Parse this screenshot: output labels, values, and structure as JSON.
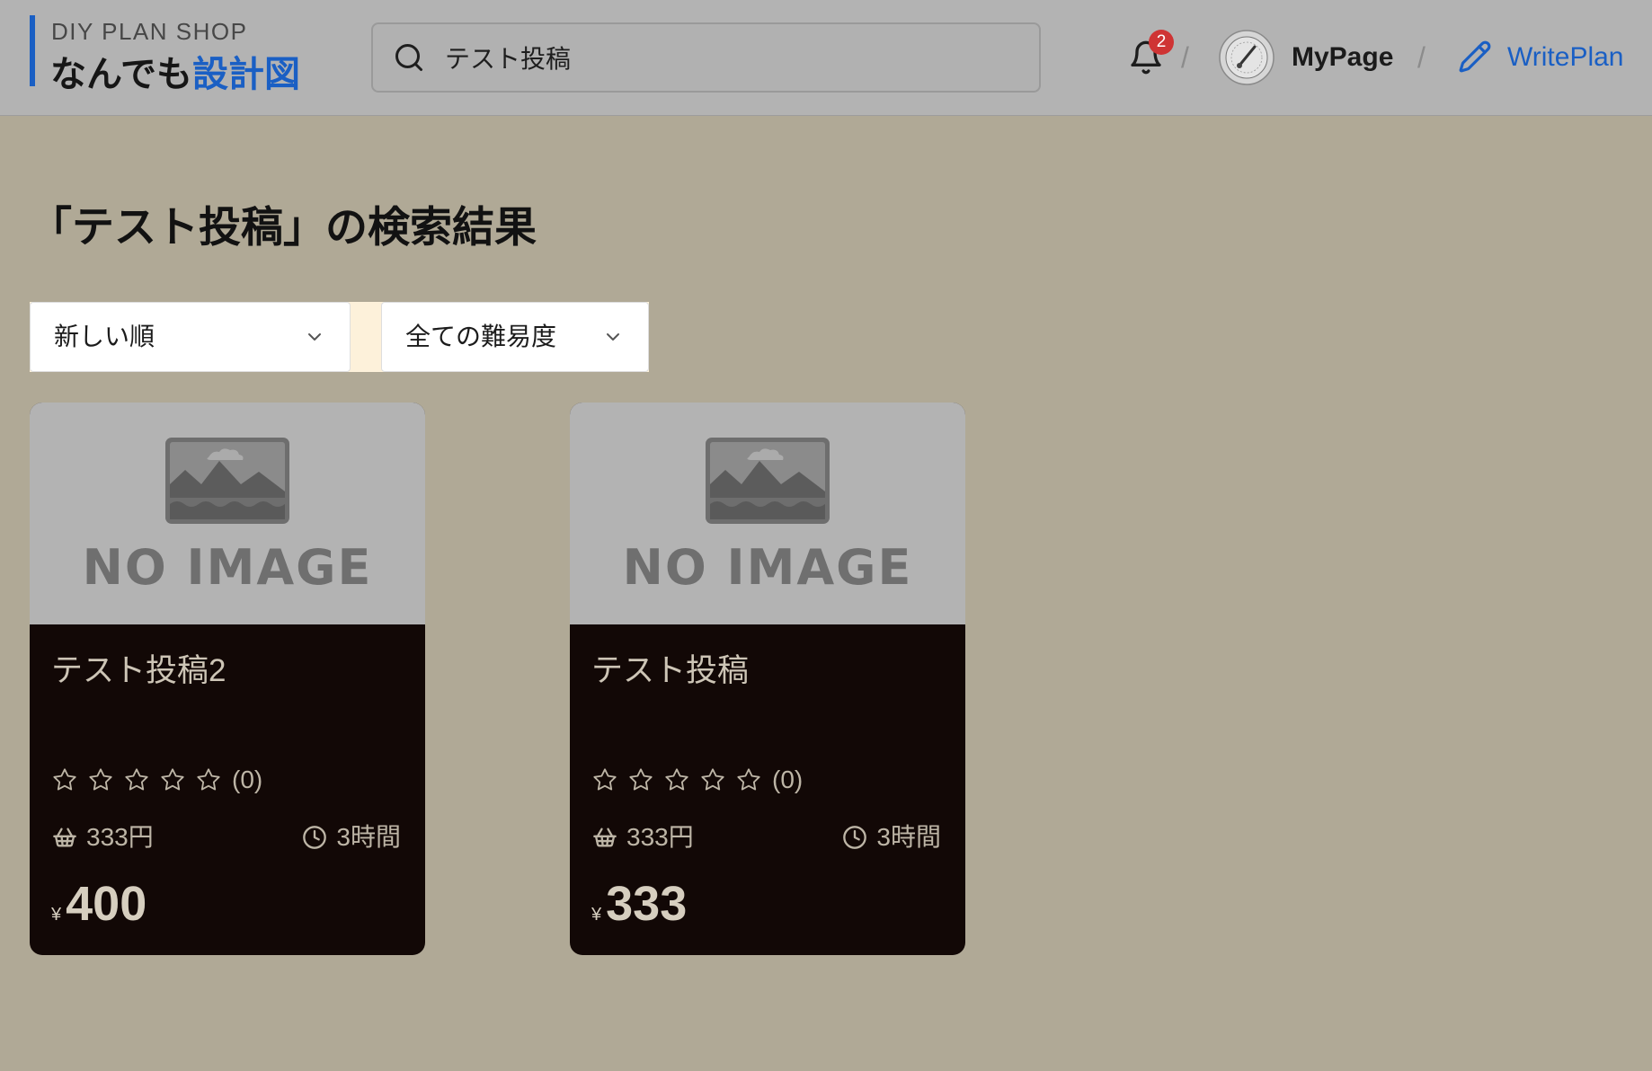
{
  "header": {
    "logo": {
      "subtitle": "DIY PLAN SHOP",
      "title_main": "なんでも",
      "title_accent": "設計図"
    },
    "search": {
      "value": "テスト投稿",
      "icon": "search-icon"
    },
    "notifications": {
      "icon": "bell-icon",
      "count": "2"
    },
    "separator": "/",
    "mypage": {
      "label": "MyPage",
      "avatar_icon": "avatar-image"
    },
    "writeplan": {
      "label": "WritePlan",
      "icon": "pencil-icon"
    }
  },
  "page": {
    "title": "「テスト投稿」の検索結果"
  },
  "filters": {
    "sort": {
      "selected": "新しい順",
      "icon": "chevron-down-icon"
    },
    "difficulty": {
      "selected": "全ての難易度",
      "icon": "chevron-down-icon"
    }
  },
  "cards": [
    {
      "image_text": "NO IMAGE",
      "title": "テスト投稿2",
      "rating": 0,
      "rating_max": 5,
      "rating_count": "(0)",
      "cost": "333円",
      "time": "3時間",
      "currency": "¥",
      "price": "400"
    },
    {
      "image_text": "NO IMAGE",
      "title": "テスト投稿",
      "rating": 0,
      "rating_max": 5,
      "rating_count": "(0)",
      "cost": "333円",
      "time": "3時間",
      "currency": "¥",
      "price": "333"
    }
  ],
  "colors": {
    "accent": "#1a5fc4",
    "badge": "#cf3434",
    "header_bg": "#b3b3b3",
    "page_bg": "#b0a996",
    "filter_bar": "#fdf1da",
    "card_body": "#120806",
    "card_text": "#cdc5b6"
  }
}
